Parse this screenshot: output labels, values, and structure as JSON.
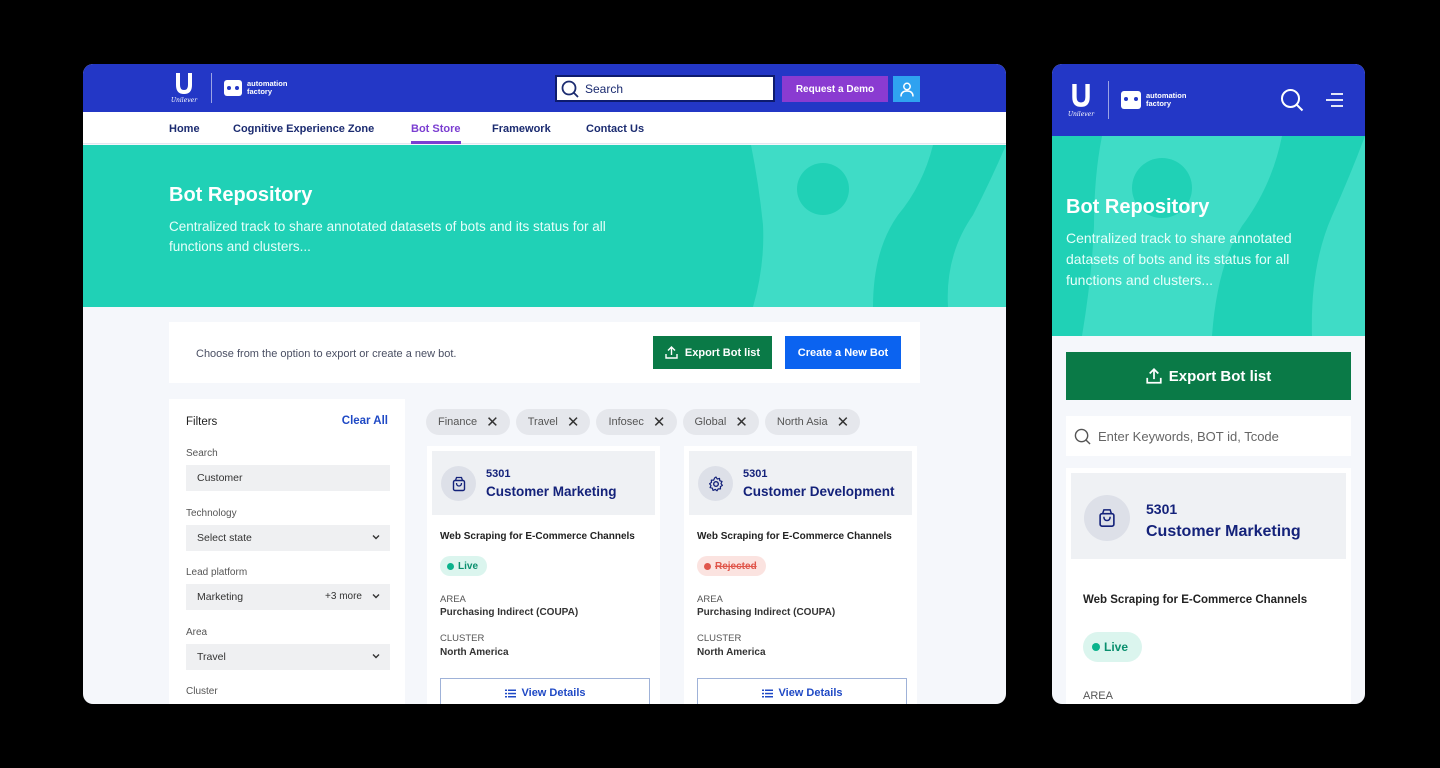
{
  "brand": {
    "unilever_wordmark": "Unilever",
    "product_name_line1": "automation",
    "product_name_line2": "factory"
  },
  "header": {
    "search_placeholder": "Search",
    "demo_label": "Request a Demo"
  },
  "nav": {
    "items": [
      {
        "label": "Home"
      },
      {
        "label": "Cognitive Experience Zone"
      },
      {
        "label": "Bot Store",
        "active": true
      },
      {
        "label": "Framework"
      },
      {
        "label": "Contact Us"
      }
    ]
  },
  "hero": {
    "title": "Bot Repository",
    "description": "Centralized track to share annotated datasets of bots and its status for all functions and clusters..."
  },
  "actions": {
    "hint": "Choose from the option to export or create a new bot.",
    "export_label": "Export Bot list",
    "create_label": "Create a New Bot"
  },
  "filters": {
    "title": "Filters",
    "clear_label": "Clear All",
    "search": {
      "label": "Search",
      "value": "Customer"
    },
    "technology": {
      "label": "Technology",
      "value": "Select state"
    },
    "lead_platform": {
      "label": "Lead platform",
      "value": "Marketing",
      "more": "+3 more"
    },
    "area": {
      "label": "Area",
      "value": "Travel"
    },
    "cluster": {
      "label": "Cluster"
    }
  },
  "chips": [
    "Finance",
    "Travel",
    "Infosec",
    "Global",
    "North Asia"
  ],
  "cards": [
    {
      "id": "5301",
      "name": "Customer Marketing",
      "icon": "shopping-bag-icon",
      "subtitle": "Web Scraping for E-Commerce Channels",
      "status": "Live",
      "area_label": "AREA",
      "area_value": "Purchasing Indirect (COUPA)",
      "cluster_label": "CLUSTER",
      "cluster_value": "North America",
      "view_label": "View Details"
    },
    {
      "id": "5301",
      "name": "Customer Development",
      "icon": "gear-icon",
      "subtitle": "Web Scraping for E-Commerce Channels",
      "status": "Rejected",
      "area_label": "AREA",
      "area_value": "Purchasing Indirect (COUPA)",
      "cluster_label": "CLUSTER",
      "cluster_value": "North America",
      "view_label": "View Details"
    }
  ],
  "mobile": {
    "search_placeholder": "Enter Keywords, BOT id, Tcode",
    "card": {
      "id": "5301",
      "name": "Customer Marketing",
      "subtitle": "Web Scraping for E-Commerce Channels",
      "status": "Live",
      "area_label": "AREA"
    }
  },
  "colors": {
    "header": "#2337c6",
    "hero": "#20d1b6",
    "demo": "#8a3bd1",
    "export": "#0a7a47",
    "create": "#0b63f0",
    "active_nav": "#7b3ed1"
  }
}
